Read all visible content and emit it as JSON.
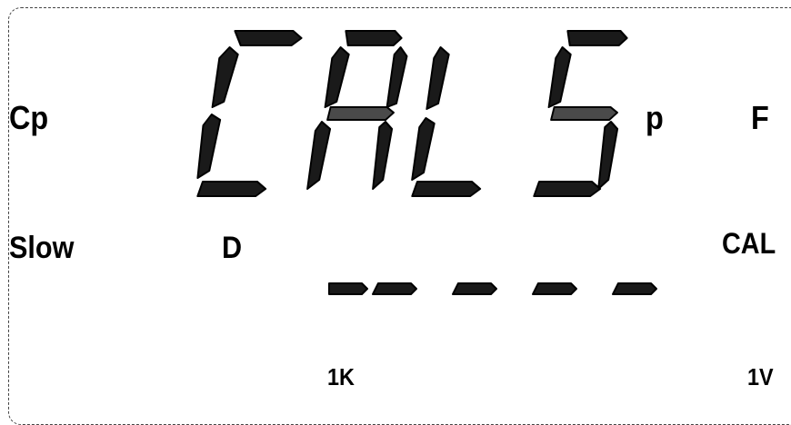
{
  "display": {
    "main_text": "CALS",
    "prefix": "p",
    "unit": "F",
    "primary_param": "Cp",
    "speed": "Slow",
    "secondary_param": "D",
    "secondary_value": "-----",
    "mode": "CAL",
    "frequency": "1K",
    "voltage": "1V"
  }
}
